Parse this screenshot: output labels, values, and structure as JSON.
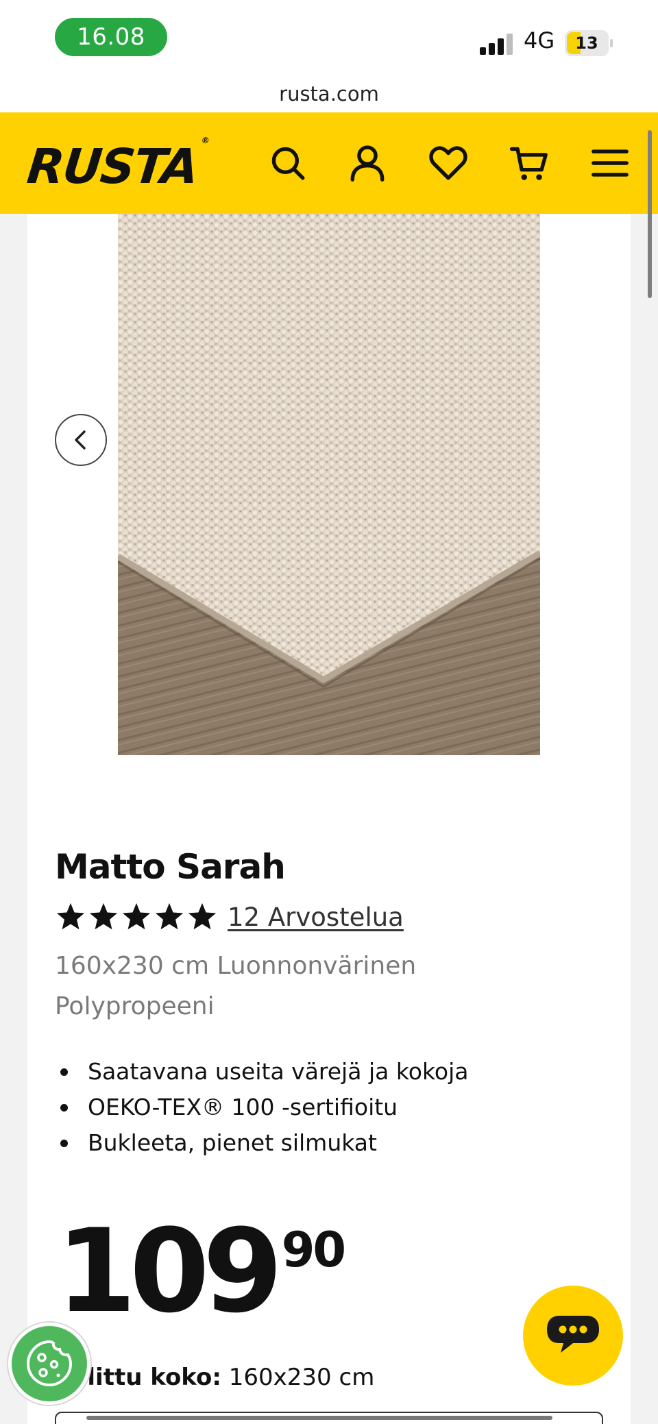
{
  "status_bar": {
    "time": "16.08",
    "network": "4G",
    "battery_level": "13"
  },
  "browser": {
    "url": "rusta.com"
  },
  "header": {
    "logo_text": "RUSTA",
    "logo_mark": "®",
    "icons": [
      "search-icon",
      "account-icon",
      "wishlist-heart-icon",
      "cart-icon",
      "menu-icon"
    ],
    "accent_color": "#ffd100"
  },
  "product": {
    "title": "Matto Sarah",
    "rating_stars": 5,
    "reviews_label": "12 Arvostelua",
    "subtitle": "160x230 cm Luonnonvärinen Polypropeeni",
    "features": [
      "Saatavana useita värejä ja kokoja",
      "OEKO-TEX® 100 -sertifioitu",
      "Bukleeta, pienet silmukat"
    ],
    "price_integer": "109",
    "price_decimal": "90",
    "size_label": "Valittu koko:",
    "size_value": "160x230 cm"
  },
  "colors": {
    "status_green": "#27a843",
    "cookie_green": "#4fb85c",
    "chat_yellow": "#ffd100"
  }
}
